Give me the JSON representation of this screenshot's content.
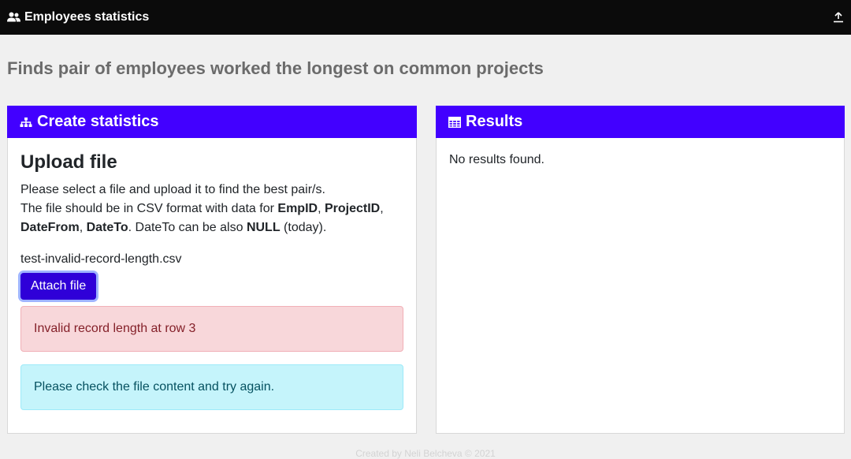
{
  "app": {
    "title": "Employees statistics"
  },
  "page": {
    "heading": "Finds pair of employees worked the longest on common projects"
  },
  "create_card": {
    "title": "Create statistics",
    "upload_title": "Upload file",
    "desc_line1": "Please select a file and upload it to find the best pair/s.",
    "desc_prefix": "The file should be in CSV format with data for ",
    "field_empid": "EmpID",
    "sep1": ", ",
    "field_projectid": "ProjectID",
    "sep2": ",",
    "field_datefrom": "DateFrom",
    "sep3": ", ",
    "field_dateto": "DateTo",
    "desc_mid": ". DateTo can be also ",
    "null_text": "NULL",
    "desc_suffix": " (today).",
    "filename": "test-invalid-record-length.csv",
    "attach_label": "Attach file",
    "error_message": "Invalid record length at row 3",
    "info_message": "Please check the file content and try again."
  },
  "results_card": {
    "title": "Results",
    "empty_text": "No results found."
  },
  "footer": {
    "text": "Created by Neli Belcheva © 2021"
  },
  "colors": {
    "accent": "#4200ff",
    "button": "#2f00d8",
    "danger_bg": "#f8d7da",
    "info_bg": "#c5f4fb",
    "topbar": "#0b0b0b"
  },
  "icons": {
    "brand": "users-icon",
    "upload": "upload-icon",
    "create": "sitemap-icon",
    "results": "table-icon"
  }
}
